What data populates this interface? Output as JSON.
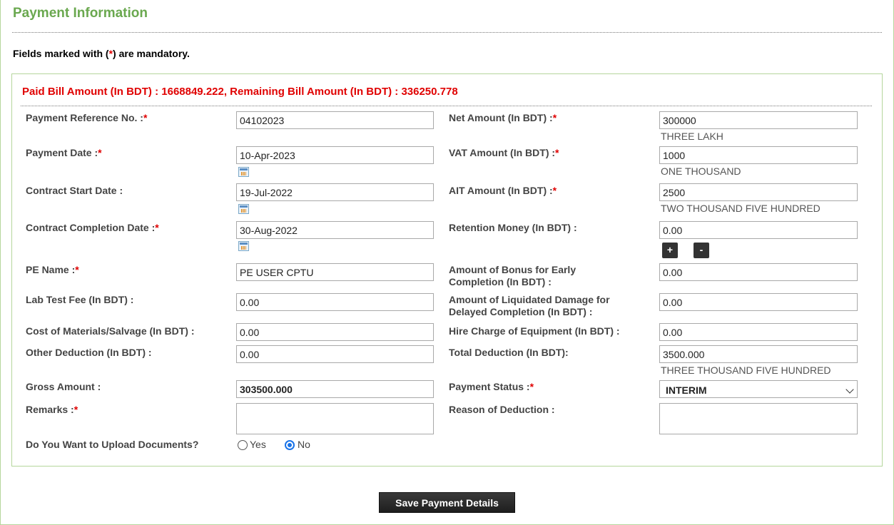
{
  "page": {
    "title": "Payment Information",
    "mandatory_note_prefix": "Fields marked with (",
    "mandatory_note_star": "*",
    "mandatory_note_suffix": ") are mandatory."
  },
  "summary": "Paid Bill Amount (In BDT) : 1668849.222, Remaining Bill Amount (In BDT) : 336250.778",
  "required_marker": "*",
  "left_fields": {
    "payment_ref": {
      "label": "Payment Reference No. :",
      "value": "04102023"
    },
    "payment_date": {
      "label": "Payment Date :",
      "value": "10-Apr-2023"
    },
    "contract_start": {
      "label": "Contract Start Date :",
      "value": "19-Jul-2022"
    },
    "contract_completion": {
      "label": "Contract Completion Date :",
      "value": "30-Aug-2022"
    },
    "pe_name": {
      "label": "PE Name :",
      "value": "PE USER CPTU"
    },
    "lab_test_fee": {
      "label": "Lab Test Fee (In BDT) :",
      "value": "0.00"
    },
    "cost_materials": {
      "label": "Cost of Materials/Salvage (In BDT) :",
      "value": "0.00"
    },
    "other_deduction": {
      "label": "Other Deduction (In BDT) :",
      "value": "0.00"
    },
    "gross_amount": {
      "label": "Gross Amount :",
      "value": "303500.000"
    },
    "remarks": {
      "label": "Remarks :",
      "value": ""
    },
    "upload_docs": {
      "label": "Do You Want to Upload Documents?",
      "yes": "Yes",
      "no": "No",
      "selected": "No"
    }
  },
  "right_fields": {
    "net_amount": {
      "label": "Net Amount (In BDT) :",
      "value": "300000",
      "words": "THREE LAKH"
    },
    "vat_amount": {
      "label": "VAT Amount (In BDT) :",
      "value": "1000",
      "words": "ONE THOUSAND"
    },
    "ait_amount": {
      "label": "AIT Amount (In BDT) :",
      "value": "2500",
      "words": "TWO THOUSAND FIVE HUNDRED"
    },
    "retention_money": {
      "label": "Retention Money (In BDT) :",
      "value": "0.00",
      "plus": "+",
      "minus": "-"
    },
    "bonus_early": {
      "label_line1": "Amount of Bonus for Early",
      "label_line2": "Completion (In BDT) :",
      "value": "0.00"
    },
    "liquidated_damage": {
      "label_line1": "Amount of Liquidated Damage for",
      "label_line2": "Delayed Completion (In BDT) :",
      "value": "0.00"
    },
    "hire_charge": {
      "label": "Hire Charge of Equipment (In BDT) :",
      "value": "0.00"
    },
    "total_deduction": {
      "label": "Total Deduction (In BDT):",
      "value": "3500.000",
      "words": "THREE THOUSAND FIVE HUNDRED"
    },
    "payment_status": {
      "label": "Payment Status :",
      "value": "INTERIM"
    },
    "reason_deduction": {
      "label": "Reason of Deduction :",
      "value": ""
    }
  },
  "actions": {
    "save_label": "Save Payment Details"
  },
  "colors": {
    "title_green": "#6aa84f",
    "required_red": "#e00000",
    "border_green": "#b5d69c",
    "radio_blue": "#1a73e8"
  },
  "icons": {
    "date_picker": "calendar-icon",
    "dropdown": "chevron-down-icon"
  }
}
